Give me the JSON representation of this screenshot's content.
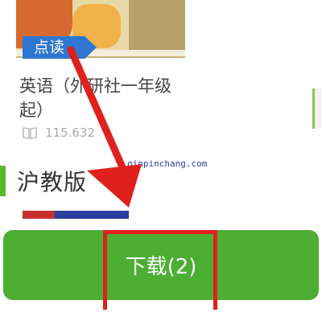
{
  "book": {
    "read_tag": "点读",
    "title": "英语（外研社一年级起）",
    "count": "115.632"
  },
  "watermark": "qinpinchang.com",
  "section": {
    "title": "沪教版"
  },
  "download": {
    "label": "下载(2)"
  },
  "colors": {
    "accent_green": "#4caf34",
    "tag_blue": "#2f76d2",
    "highlight_red": "#e0201c",
    "arrow_red": "#e0201c"
  },
  "icons": {
    "book": "book-icon"
  }
}
